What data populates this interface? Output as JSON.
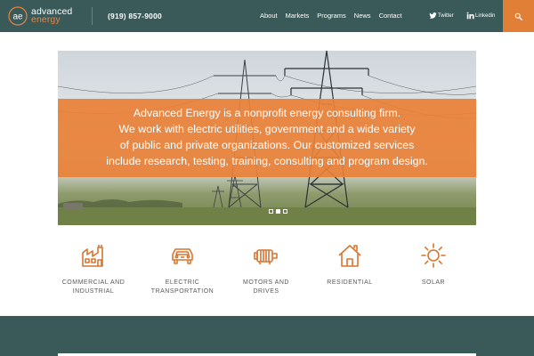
{
  "brand": {
    "name_line1": "advanced",
    "name_line2": "energy",
    "logo_letters": "ae"
  },
  "header": {
    "phone": "(919) 857-9000"
  },
  "nav": {
    "items": [
      "About",
      "Markets",
      "Programs",
      "News",
      "Contact"
    ]
  },
  "social": {
    "twitter": "Twitter",
    "linkedin": "Linkedin"
  },
  "hero": {
    "caption_lines": [
      "Advanced Energy is a nonprofit energy consulting firm.",
      "We work with electric utilities, government and a wide variety",
      "of public and private organizations. Our customized services",
      "include research, testing, training, consulting and program design."
    ],
    "slides": 3,
    "active_slide": 2
  },
  "services": [
    {
      "label": "COMMERCIAL AND\nINDUSTRIAL",
      "icon": "factory-icon"
    },
    {
      "label": "ELECTRIC\nTRANSPORTATION",
      "icon": "car-icon"
    },
    {
      "label": "MOTORS AND\nDRIVES",
      "icon": "motor-icon"
    },
    {
      "label": "RESIDENTIAL",
      "icon": "house-icon"
    },
    {
      "label": "SOLAR",
      "icon": "sun-icon"
    }
  ],
  "colors": {
    "header": "#3a5a5a",
    "accent": "#e07f35",
    "icon": "#d9752e"
  }
}
